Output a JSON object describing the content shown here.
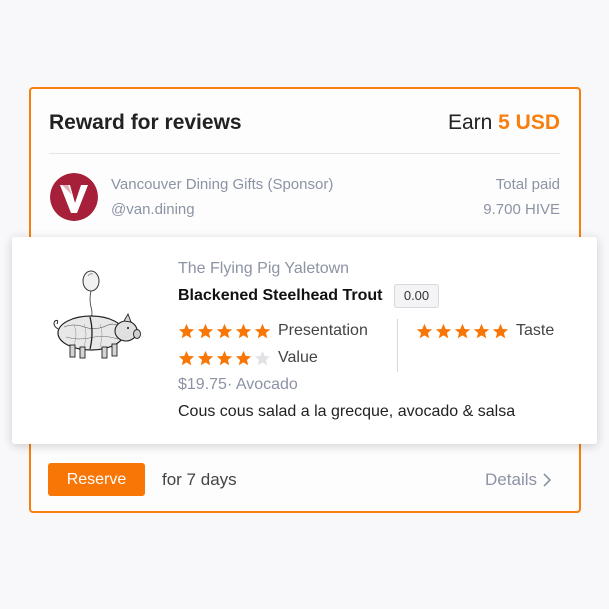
{
  "header": {
    "title": "Reward for reviews",
    "earn_label": "Earn",
    "earn_amount": "5 USD"
  },
  "sponsor": {
    "name": "Vancouver Dining Gifts (Sponsor)",
    "handle": "@van.dining",
    "logo_icon": "letter-v-logo",
    "logo_color": "#a6203a",
    "total_paid_label": "Total paid",
    "total_paid_value": "9.700 HIVE"
  },
  "dish": {
    "restaurant": "The Flying Pig Yaletown",
    "name": "Blackened Steelhead Trout",
    "score": "0.00",
    "image_icon": "flying-pig-illustration",
    "ratings": [
      {
        "label": "Presentation",
        "stars": 5
      },
      {
        "label": "Value",
        "stars": 4
      },
      {
        "label": "Taste",
        "stars": 5
      }
    ],
    "price": "$19.75",
    "price_separator": "·",
    "diet": "Avocado",
    "description": "Cous cous salad a la grecque, avocado & salsa"
  },
  "footer": {
    "reserve_label": "Reserve",
    "duration": "for 7 days",
    "details_label": "Details",
    "details_icon": "chevron-right-icon"
  },
  "colors": {
    "accent": "#f77f0d",
    "star_filled": "#f77606",
    "star_empty": "#e2e2e6",
    "muted_text": "#8b93a4"
  }
}
